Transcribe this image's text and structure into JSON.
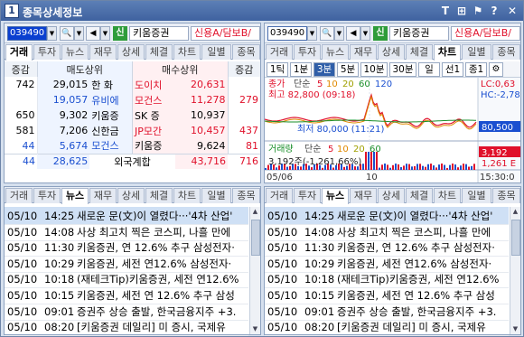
{
  "window": {
    "title": "종목상세정보",
    "app_icon": "1",
    "buttons": [
      "T",
      "⊞",
      "⚑",
      "?",
      "✕"
    ]
  },
  "left": {
    "code": "039490",
    "stock_name": "키움증권",
    "credit": "신용A/담보B/",
    "badge": "신",
    "tabs": [
      "거래",
      "투자",
      "뉴스",
      "재무",
      "상세",
      "체결",
      "차트",
      "일별",
      "종목"
    ],
    "active_tab": "거래",
    "header": {
      "col1": "증감",
      "col2": "매도상위",
      "col3": "매수상위",
      "col4": "증감"
    },
    "rows": [
      {
        "sell_chg": "742",
        "sell_qty": "29,015",
        "sell_br": "한 화",
        "buy_br": "도이치",
        "buy_qty": "20,631",
        "buy_chg": "",
        "sc": "#000",
        "bc": "#e0102a",
        "sbc": "#000",
        "bbc": "#e0102a"
      },
      {
        "sell_chg": "",
        "sell_qty": "19,057",
        "sell_br": "유비에",
        "buy_br": "모건스",
        "buy_qty": "11,278",
        "buy_chg": "279",
        "sc": "#1a4fd0",
        "bc": "#e0102a",
        "sbc": "#1a4fd0",
        "bbc": "#e0102a"
      },
      {
        "sell_chg": "650",
        "sell_qty": "9,302",
        "sell_br": "키움증",
        "buy_br": "SK 증",
        "buy_qty": "10,937",
        "buy_chg": "",
        "sc": "#000",
        "bc": "#000",
        "sbc": "#000",
        "bbc": "#000"
      },
      {
        "sell_chg": "581",
        "sell_qty": "7,206",
        "sell_br": "신한금",
        "buy_br": "JP모간",
        "buy_qty": "10,457",
        "buy_chg": "437",
        "sc": "#000",
        "bc": "#e0102a",
        "sbc": "#000",
        "bbc": "#e0102a"
      },
      {
        "sell_chg": "44",
        "sell_qty": "5,674",
        "sell_br": "모건스",
        "buy_br": "키움증",
        "buy_qty": "9,624",
        "buy_chg": "81",
        "sc": "#1a4fd0",
        "bc": "#000",
        "sbc": "#1a4fd0",
        "bbc": "#000"
      }
    ],
    "foreign": {
      "sell_chg": "44",
      "sell_qty": "28,625",
      "label": "외국계합",
      "buy_qty": "43,716",
      "buy_chg": "716"
    }
  },
  "right": {
    "code": "039490",
    "stock_name": "키움증권",
    "credit": "신용A/담보B/",
    "badge": "신",
    "tabs": [
      "거래",
      "투자",
      "뉴스",
      "재무",
      "상세",
      "체결",
      "차트",
      "일별",
      "종목"
    ],
    "active_tab": "차트",
    "intervals": [
      "1틱",
      "1분",
      "3분",
      "5분",
      "10분",
      "30분",
      "일",
      "선1",
      "종1"
    ],
    "active_interval": "3분",
    "price_legend": {
      "label": "종가",
      "sub": "단순",
      "ma": [
        "5",
        "10",
        "20",
        "60",
        "120"
      ]
    },
    "high": "최고 82,800 (09:18)",
    "low": "최저 80,000 (11:21)",
    "lc": "LC:0,63",
    "hc": "HC:-2,78",
    "last_price": "80,500",
    "last_vol": "3,192",
    "last_vol2": "1,261 E",
    "vol_legend": {
      "label": "거래량",
      "sub": "단순",
      "ma": [
        "5",
        "10",
        "20",
        "60"
      ]
    },
    "vol_value": "3,192주(-1,261,66%)",
    "x_labels": [
      "05/06",
      "10",
      "15:30:0"
    ]
  },
  "news": {
    "tabs": [
      "거래",
      "투자",
      "뉴스",
      "재무",
      "상세",
      "체결",
      "차트",
      "일별",
      "종목"
    ],
    "active_tab": "뉴스",
    "items": [
      {
        "date": "05/10",
        "time": "14:25",
        "headline": "새로운 문(文)이 열렸다···'4차 산업'"
      },
      {
        "date": "05/10",
        "time": "14:08",
        "headline": "사상 최고치 찍은 코스피, 나흘 만에"
      },
      {
        "date": "05/10",
        "time": "11:30",
        "headline": "키움증권, 연 12.6% 추구 삼성전자·"
      },
      {
        "date": "05/10",
        "time": "10:29",
        "headline": "키움증권, 세전 연12.6% 삼성전자·"
      },
      {
        "date": "05/10",
        "time": "10:18",
        "headline": "(재테크Tip)키움증권, 세전 연12.6%"
      },
      {
        "date": "05/10",
        "time": "10:15",
        "headline": "키움증권, 세전 연 12.6% 추구 삼성"
      },
      {
        "date": "05/10",
        "time": "09:01",
        "headline": "증권주 상승 출발, 한국금융지주 +3."
      },
      {
        "date": "05/10",
        "time": "08:20",
        "headline": "[키움증권 데일리] 미 증시, 국제유"
      }
    ]
  },
  "colors": {
    "up": "#e0102a",
    "down": "#1a4fd0",
    "chart_bg": "#ffffff",
    "price_line": "#e0102a"
  }
}
